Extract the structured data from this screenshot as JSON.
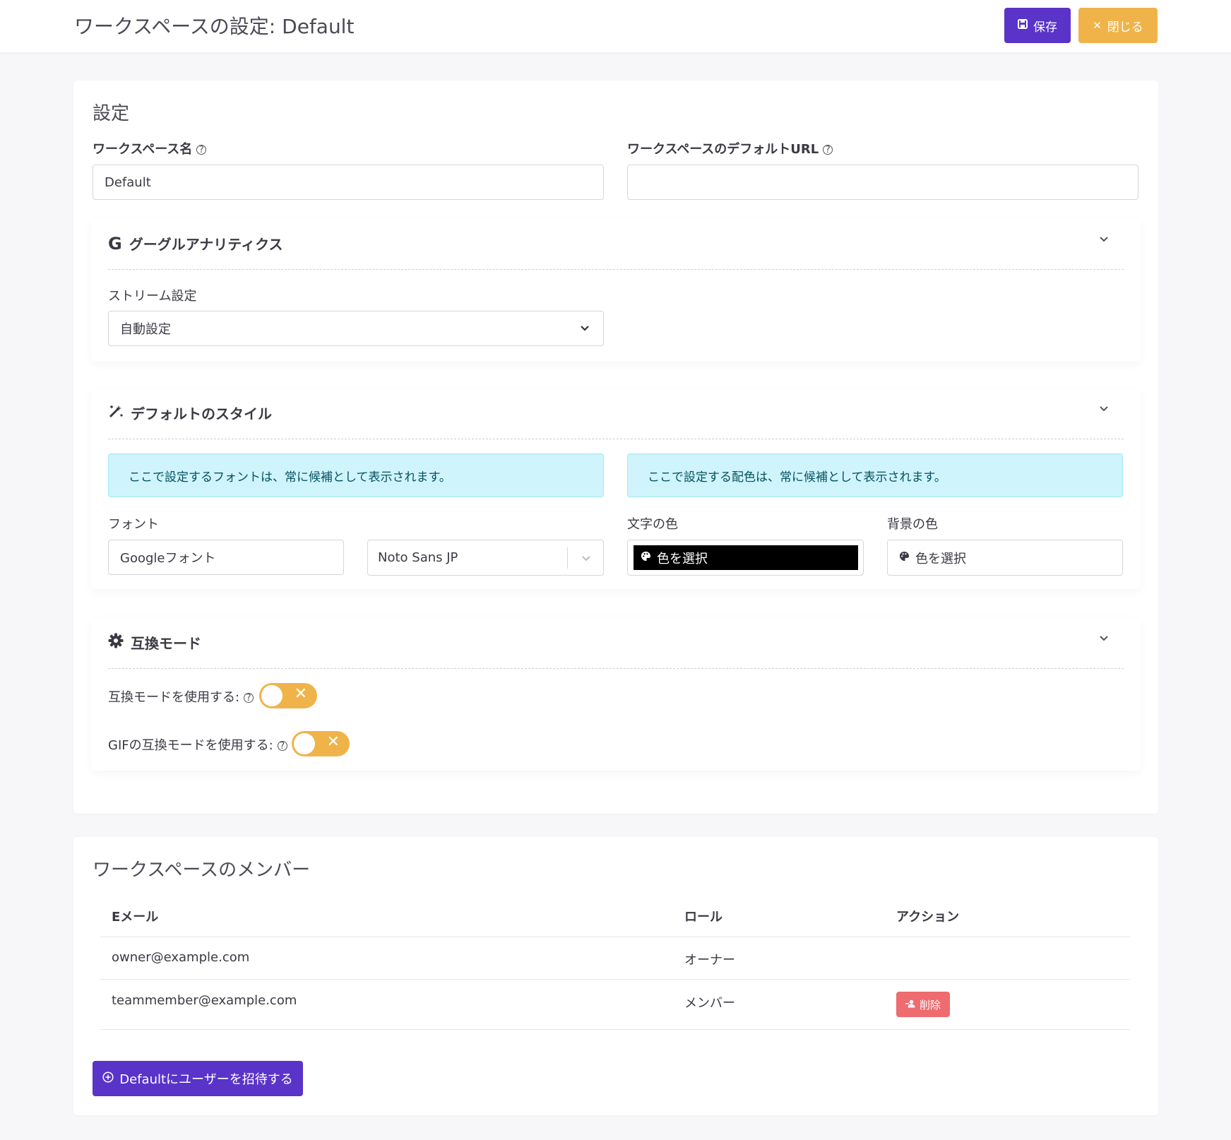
{
  "header": {
    "title": "ワークスペースの設定: Default",
    "save_label": "保存",
    "close_label": "閉じる"
  },
  "settings": {
    "title": "設定",
    "workspace_name_label": "ワークスペース名",
    "workspace_name_value": "Default",
    "default_url_label": "ワークスペースのデフォルトURL",
    "default_url_value": "",
    "help_glyph": "?",
    "chevron_glyph": "⌄"
  },
  "google_analytics": {
    "title": "グーグルアナリティクス",
    "icon_glyph": "G",
    "stream_label": "ストリーム設定",
    "stream_value": "自動設定"
  },
  "default_style": {
    "title": "デフォルトのスタイル",
    "font_info": "ここで設定するフォントは、常に候補として表示されます。",
    "color_info": "ここで設定する配色は、常に候補として表示されます。",
    "font_label": "フォント",
    "font_source_value": "Googleフォント",
    "font_family_value": "Noto Sans JP",
    "text_color_label": "文字の色",
    "text_color_value": "色を選択",
    "bg_color_label": "背景の色",
    "bg_color_value": "色を選択"
  },
  "compat": {
    "title": "互換モード",
    "use_compat_label": "互換モードを使用する:",
    "use_gif_compat_label": "GIFの互換モードを使用する:",
    "use_compat_state": false,
    "use_gif_compat_state": false
  },
  "members": {
    "title": "ワークスペースのメンバー",
    "columns": [
      "Eメール",
      "ロール",
      "アクション"
    ],
    "rows": [
      {
        "email": "owner@example.com",
        "role": "オーナー",
        "action": ""
      },
      {
        "email": "teammember@example.com",
        "role": "メンバー",
        "action": "削除"
      }
    ],
    "invite_label": "Defaultにユーザーを招待する"
  },
  "colors": {
    "primary": "#5a33c9",
    "warning": "#f0b34a",
    "danger": "#ee6b6f",
    "info_bg": "#cff4fc"
  }
}
